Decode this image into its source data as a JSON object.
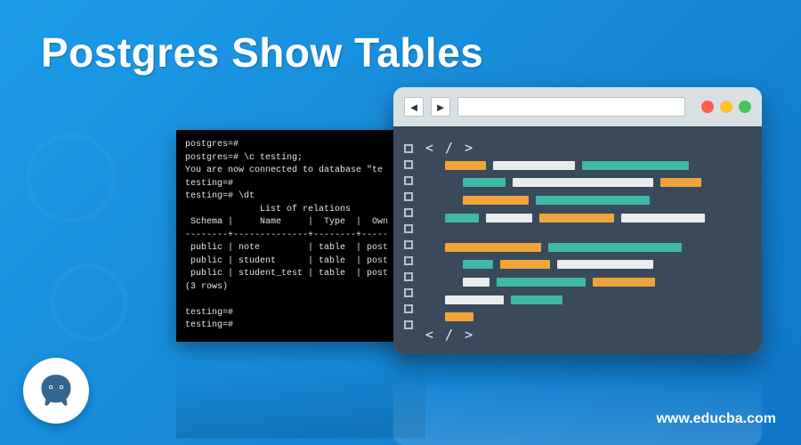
{
  "title": "Postgres Show Tables",
  "footer_url": "www.educba.com",
  "terminal": {
    "line1": "postgres=#",
    "line2": "postgres=# \\c testing;",
    "line3": "You are now connected to database \"te",
    "line4": "testing=#",
    "line5": "testing=# \\dt",
    "heading": "              List of relations",
    "header_row": " Schema |     Name     |  Type  |  Own",
    "divider": "--------+--------------+--------+-----",
    "row1": " public | note         | table  | post",
    "row2": " public | student      | table  | post",
    "row3": " public | student_test | table  | post",
    "count": "(3 rows)",
    "blank": "",
    "prompt1": "testing=#",
    "prompt2": "testing=#"
  },
  "editor": {
    "open_tag": "< / >",
    "close_tag": "< / >"
  },
  "icons": {
    "back": "◄",
    "fwd": "►"
  }
}
